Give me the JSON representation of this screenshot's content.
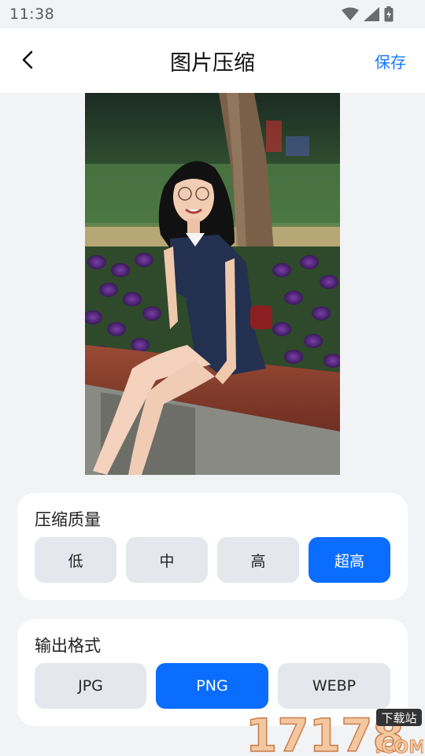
{
  "status": {
    "time": "11:38"
  },
  "header": {
    "title": "图片压缩",
    "save_label": "保存"
  },
  "quality": {
    "label": "压缩质量",
    "options": [
      "低",
      "中",
      "高",
      "超高"
    ],
    "selected": "超高"
  },
  "format": {
    "label": "输出格式",
    "options": [
      "JPG",
      "PNG",
      "WEBP"
    ],
    "selected": "PNG"
  },
  "colors": {
    "accent": "#0a6dff",
    "link": "#1677ff",
    "option_bg": "#e4e7ec"
  },
  "watermark": {
    "number": "17178",
    "site": "下载站",
    "suffix": ".COM"
  }
}
